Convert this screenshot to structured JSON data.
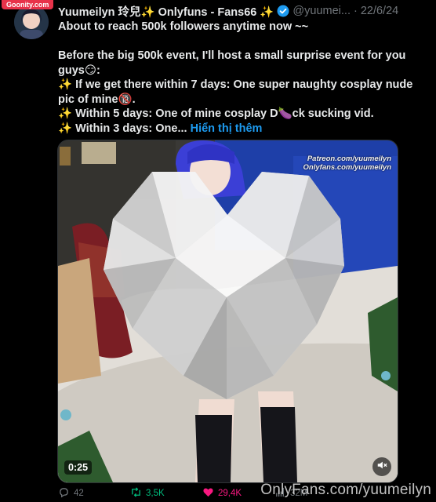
{
  "site_watermark": "Goonity.com",
  "tweet": {
    "display_name": "Yuumeilyn 玲兒✨ Onlyfuns - Fans66 ✨",
    "handle": "@yuumei...",
    "separator": "·",
    "date": "22/6/24",
    "lines": [
      "About to reach 500k followers anytime now ~~",
      "",
      "Before the big 500k event, I'll host a small surprise event for you guys😏:",
      "✨ If we get there within 7 days: One super naughty cosplay nude pic of mine🔞.",
      "✨ Within 5 days: One of mine cosplay D🍆ck sucking vid."
    ],
    "last_line_prefix": "✨ Within 3 days: One...",
    "show_more": "Hiển thị thêm"
  },
  "media": {
    "caption_line1": "Patreon.com/yuumeilyn",
    "caption_line2": "Onlyfans.com/yuumeilyn",
    "timestamp": "0:25",
    "mute_icon": "mute-icon"
  },
  "actions": {
    "replies": "42",
    "retweets": "3,5K",
    "likes": "29,4K",
    "views": "32M"
  },
  "bottom_watermark": "OnlyFans.com/yuumeilyn",
  "colors": {
    "accent_blue": "#1d9bf0",
    "retweet_green": "#00ba7c",
    "like_pink": "#f91880",
    "muted_gray": "#71767b"
  }
}
